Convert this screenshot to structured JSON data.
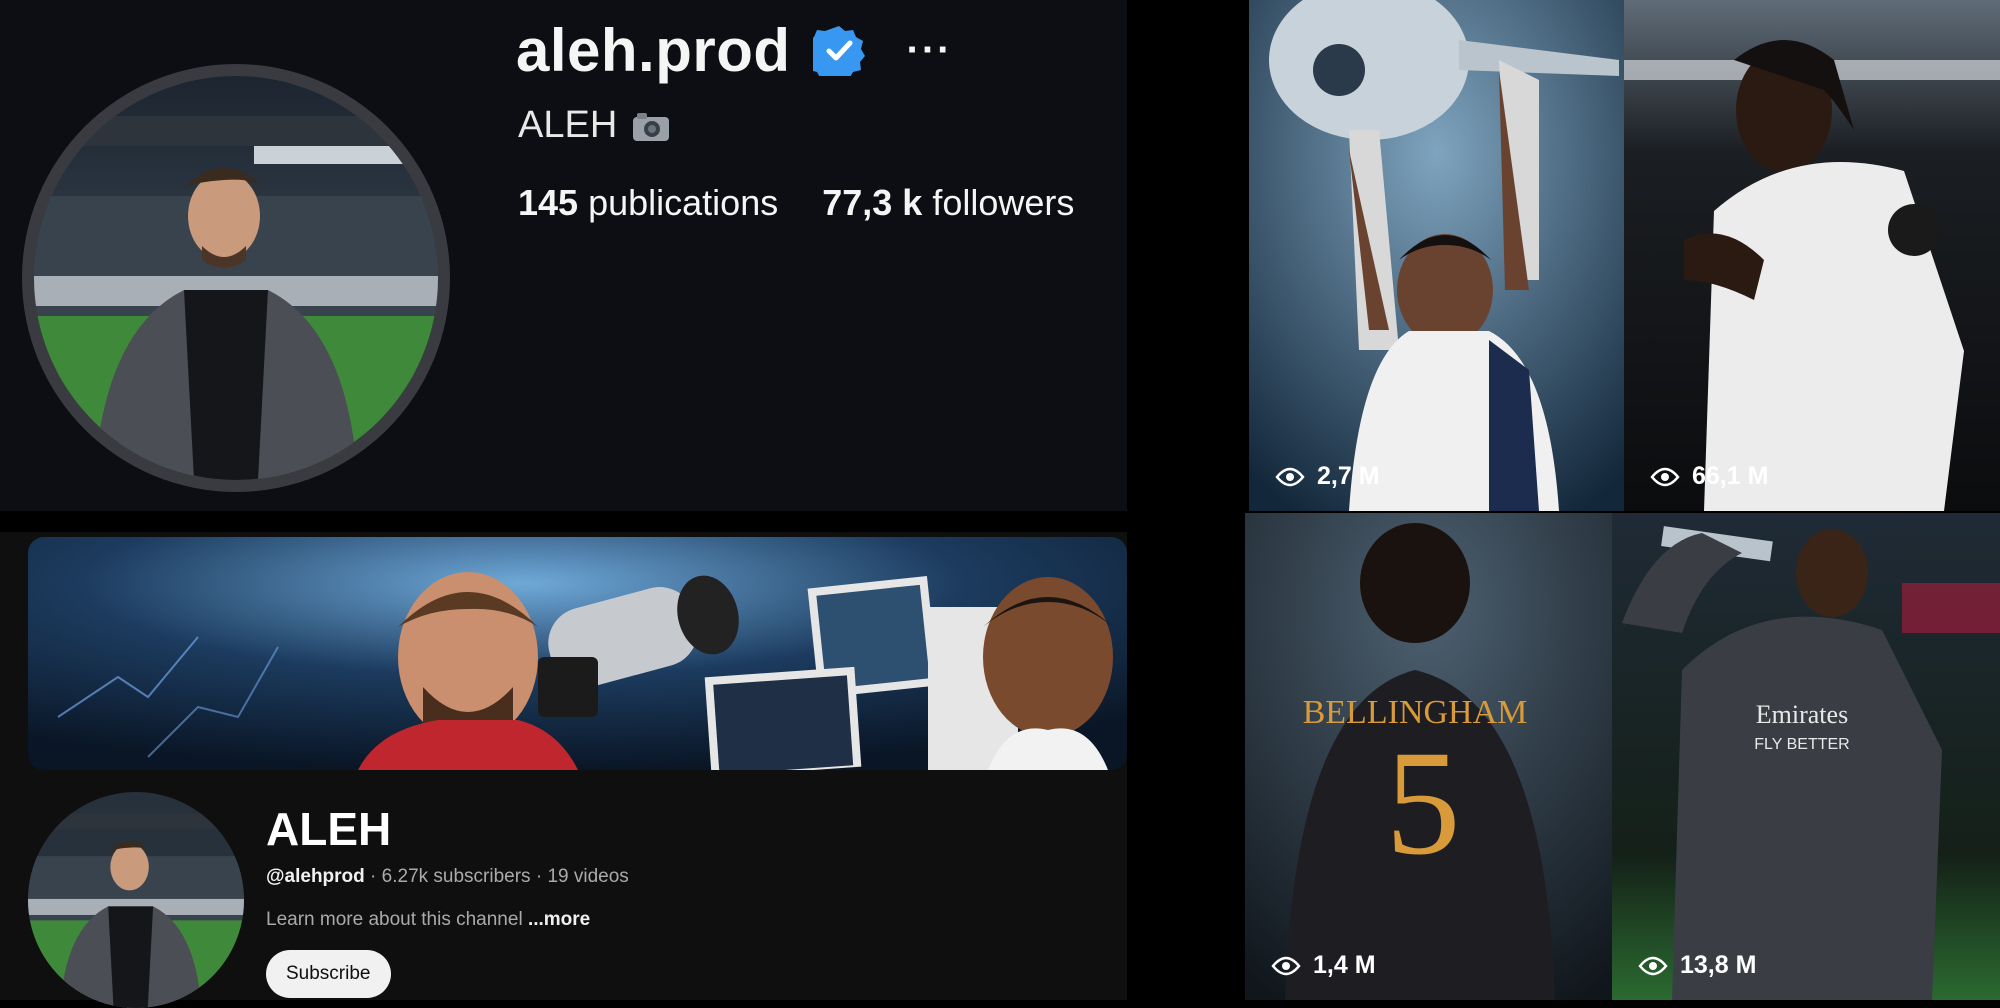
{
  "instagram": {
    "username": "aleh.prod",
    "full_name": "ALEH",
    "publications_count": "145",
    "publications_label": "publications",
    "followers_count": "77,3 k",
    "followers_label": "followers",
    "more_label": "···",
    "accent_verified": "#3897f0"
  },
  "youtube": {
    "channel_name": "ALEH",
    "handle": "@alehprod",
    "subscribers": "6.27k subscribers",
    "videos": "19 videos",
    "separator": " · ",
    "description": "Learn more about this channel",
    "more_label": "...more",
    "subscribe_label": "Subscribe"
  },
  "posts": [
    {
      "views": "2,7 M",
      "scene": "trophy-lift-white-kit"
    },
    {
      "views": "66,1 M",
      "scene": "player-white-kit-dark-stadium"
    },
    {
      "views": "1,4 M",
      "scene": "back-view-black-kit-number-5"
    },
    {
      "views": "13,8 M",
      "scene": "player-drinking-dark-kit"
    }
  ],
  "post_shirt_texts": {
    "bellingham": "BELLINGHAM",
    "number": "5",
    "emirates": "Emirates",
    "fly_better": "FLY BETTER"
  }
}
